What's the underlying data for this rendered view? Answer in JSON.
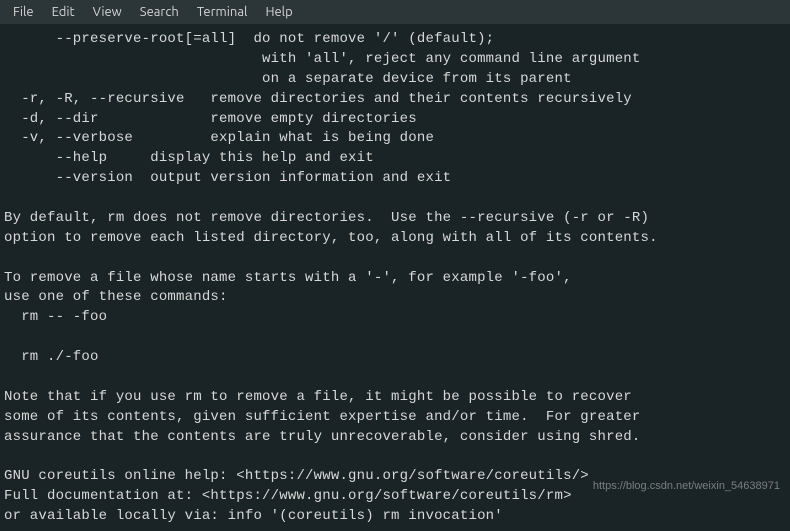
{
  "menu": {
    "file": "File",
    "edit": "Edit",
    "view": "View",
    "search": "Search",
    "terminal": "Terminal",
    "help": "Help"
  },
  "terminal": {
    "content": "      --preserve-root[=all]  do not remove '/' (default);\n                              with 'all', reject any command line argument\n                              on a separate device from its parent\n  -r, -R, --recursive   remove directories and their contents recursively\n  -d, --dir             remove empty directories\n  -v, --verbose         explain what is being done\n      --help     display this help and exit\n      --version  output version information and exit\n\nBy default, rm does not remove directories.  Use the --recursive (-r or -R)\noption to remove each listed directory, too, along with all of its contents.\n\nTo remove a file whose name starts with a '-', for example '-foo',\nuse one of these commands:\n  rm -- -foo\n\n  rm ./-foo\n\nNote that if you use rm to remove a file, it might be possible to recover\nsome of its contents, given sufficient expertise and/or time.  For greater\nassurance that the contents are truly unrecoverable, consider using shred.\n\nGNU coreutils online help: <https://www.gnu.org/software/coreutils/>\nFull documentation at: <https://www.gnu.org/software/coreutils/rm>\nor available locally via: info '(coreutils) rm invocation'"
  },
  "watermark": "https://blog.csdn.net/weixin_54638971"
}
